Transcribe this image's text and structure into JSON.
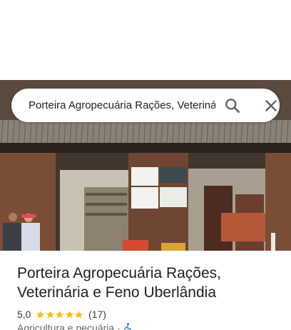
{
  "search": {
    "value": "Porteira Agropecuária Rações, Veterinária e Feno Uberlândia"
  },
  "place": {
    "name": "Porteira Agropecuária Rações, Veterinária e Feno Uberlândia",
    "rating": "5,0",
    "stars": 5,
    "review_count": "(17)",
    "category": "Agricultura e pecuária",
    "separator": "·"
  },
  "icons": {
    "search": "search-icon",
    "close": "close-icon",
    "star": "star-icon",
    "accessible": "wheelchair-accessible-icon"
  },
  "colors": {
    "star": "#fbbc04",
    "accessible": "#1a73e8",
    "title": "#202124"
  }
}
